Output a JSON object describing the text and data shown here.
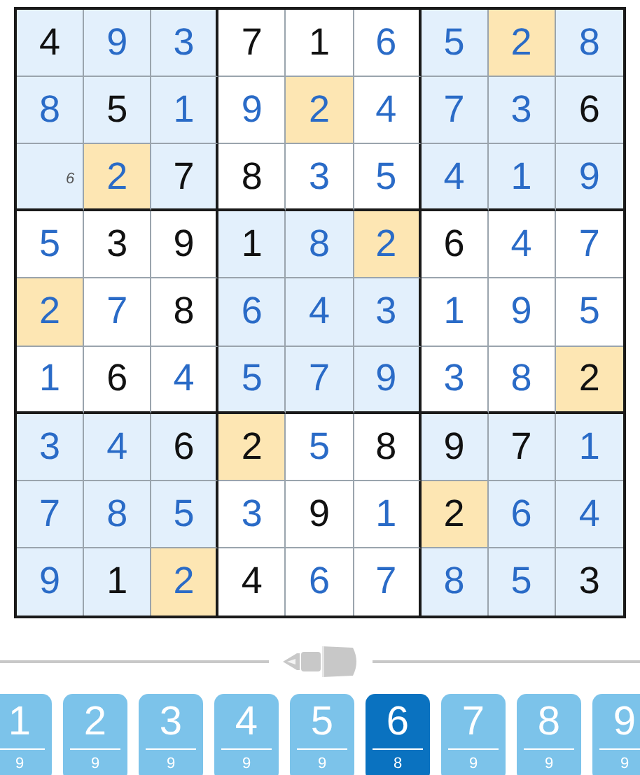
{
  "grid": [
    [
      {
        "value": "4",
        "kind": "given",
        "highlighted": false
      },
      {
        "value": "9",
        "kind": "entered",
        "highlighted": false
      },
      {
        "value": "3",
        "kind": "entered",
        "highlighted": false
      },
      {
        "value": "7",
        "kind": "given",
        "highlighted": false
      },
      {
        "value": "1",
        "kind": "given",
        "highlighted": false
      },
      {
        "value": "6",
        "kind": "entered",
        "highlighted": false
      },
      {
        "value": "5",
        "kind": "entered",
        "highlighted": false
      },
      {
        "value": "2",
        "kind": "entered",
        "highlighted": true
      },
      {
        "value": "8",
        "kind": "entered",
        "highlighted": false
      }
    ],
    [
      {
        "value": "8",
        "kind": "entered",
        "highlighted": false
      },
      {
        "value": "5",
        "kind": "given",
        "highlighted": false
      },
      {
        "value": "1",
        "kind": "entered",
        "highlighted": false
      },
      {
        "value": "9",
        "kind": "entered",
        "highlighted": false
      },
      {
        "value": "2",
        "kind": "entered",
        "highlighted": true
      },
      {
        "value": "4",
        "kind": "entered",
        "highlighted": false
      },
      {
        "value": "7",
        "kind": "entered",
        "highlighted": false
      },
      {
        "value": "3",
        "kind": "entered",
        "highlighted": false
      },
      {
        "value": "6",
        "kind": "given",
        "highlighted": false
      }
    ],
    [
      {
        "value": "6",
        "kind": "note",
        "highlighted": false
      },
      {
        "value": "2",
        "kind": "entered",
        "highlighted": true
      },
      {
        "value": "7",
        "kind": "given",
        "highlighted": false
      },
      {
        "value": "8",
        "kind": "given",
        "highlighted": false
      },
      {
        "value": "3",
        "kind": "entered",
        "highlighted": false
      },
      {
        "value": "5",
        "kind": "entered",
        "highlighted": false
      },
      {
        "value": "4",
        "kind": "entered",
        "highlighted": false
      },
      {
        "value": "1",
        "kind": "entered",
        "highlighted": false
      },
      {
        "value": "9",
        "kind": "entered",
        "highlighted": false
      }
    ],
    [
      {
        "value": "5",
        "kind": "entered",
        "highlighted": false
      },
      {
        "value": "3",
        "kind": "given",
        "highlighted": false
      },
      {
        "value": "9",
        "kind": "given",
        "highlighted": false
      },
      {
        "value": "1",
        "kind": "given",
        "highlighted": false
      },
      {
        "value": "8",
        "kind": "entered",
        "highlighted": false
      },
      {
        "value": "2",
        "kind": "entered",
        "highlighted": true
      },
      {
        "value": "6",
        "kind": "given",
        "highlighted": false
      },
      {
        "value": "4",
        "kind": "entered",
        "highlighted": false
      },
      {
        "value": "7",
        "kind": "entered",
        "highlighted": false
      }
    ],
    [
      {
        "value": "2",
        "kind": "entered",
        "highlighted": true
      },
      {
        "value": "7",
        "kind": "entered",
        "highlighted": false
      },
      {
        "value": "8",
        "kind": "given",
        "highlighted": false
      },
      {
        "value": "6",
        "kind": "entered",
        "highlighted": false
      },
      {
        "value": "4",
        "kind": "entered",
        "highlighted": false
      },
      {
        "value": "3",
        "kind": "entered",
        "highlighted": false
      },
      {
        "value": "1",
        "kind": "entered",
        "highlighted": false
      },
      {
        "value": "9",
        "kind": "entered",
        "highlighted": false
      },
      {
        "value": "5",
        "kind": "entered",
        "highlighted": false
      }
    ],
    [
      {
        "value": "1",
        "kind": "entered",
        "highlighted": false
      },
      {
        "value": "6",
        "kind": "given",
        "highlighted": false
      },
      {
        "value": "4",
        "kind": "entered",
        "highlighted": false
      },
      {
        "value": "5",
        "kind": "entered",
        "highlighted": false
      },
      {
        "value": "7",
        "kind": "entered",
        "highlighted": false
      },
      {
        "value": "9",
        "kind": "entered",
        "highlighted": false
      },
      {
        "value": "3",
        "kind": "entered",
        "highlighted": false
      },
      {
        "value": "8",
        "kind": "entered",
        "highlighted": false
      },
      {
        "value": "2",
        "kind": "given",
        "highlighted": true
      }
    ],
    [
      {
        "value": "3",
        "kind": "entered",
        "highlighted": false
      },
      {
        "value": "4",
        "kind": "entered",
        "highlighted": false
      },
      {
        "value": "6",
        "kind": "given",
        "highlighted": false
      },
      {
        "value": "2",
        "kind": "given",
        "highlighted": true
      },
      {
        "value": "5",
        "kind": "entered",
        "highlighted": false
      },
      {
        "value": "8",
        "kind": "given",
        "highlighted": false
      },
      {
        "value": "9",
        "kind": "given",
        "highlighted": false
      },
      {
        "value": "7",
        "kind": "given",
        "highlighted": false
      },
      {
        "value": "1",
        "kind": "entered",
        "highlighted": false
      }
    ],
    [
      {
        "value": "7",
        "kind": "entered",
        "highlighted": false
      },
      {
        "value": "8",
        "kind": "entered",
        "highlighted": false
      },
      {
        "value": "5",
        "kind": "entered",
        "highlighted": false
      },
      {
        "value": "3",
        "kind": "entered",
        "highlighted": false
      },
      {
        "value": "9",
        "kind": "given",
        "highlighted": false
      },
      {
        "value": "1",
        "kind": "entered",
        "highlighted": false
      },
      {
        "value": "2",
        "kind": "given",
        "highlighted": true
      },
      {
        "value": "6",
        "kind": "entered",
        "highlighted": false
      },
      {
        "value": "4",
        "kind": "entered",
        "highlighted": false
      }
    ],
    [
      {
        "value": "9",
        "kind": "entered",
        "highlighted": false
      },
      {
        "value": "1",
        "kind": "given",
        "highlighted": false
      },
      {
        "value": "2",
        "kind": "entered",
        "highlighted": true
      },
      {
        "value": "4",
        "kind": "given",
        "highlighted": false
      },
      {
        "value": "6",
        "kind": "entered",
        "highlighted": false
      },
      {
        "value": "7",
        "kind": "entered",
        "highlighted": false
      },
      {
        "value": "8",
        "kind": "entered",
        "highlighted": false
      },
      {
        "value": "5",
        "kind": "entered",
        "highlighted": false
      },
      {
        "value": "3",
        "kind": "given",
        "highlighted": false
      }
    ]
  ],
  "number_pad": [
    {
      "digit": "1",
      "remaining": "9",
      "selected": false
    },
    {
      "digit": "2",
      "remaining": "9",
      "selected": false
    },
    {
      "digit": "3",
      "remaining": "9",
      "selected": false
    },
    {
      "digit": "4",
      "remaining": "9",
      "selected": false
    },
    {
      "digit": "5",
      "remaining": "9",
      "selected": false
    },
    {
      "digit": "6",
      "remaining": "8",
      "selected": true
    },
    {
      "digit": "7",
      "remaining": "9",
      "selected": false
    },
    {
      "digit": "8",
      "remaining": "9",
      "selected": false
    },
    {
      "digit": "9",
      "remaining": "9",
      "selected": false
    }
  ]
}
